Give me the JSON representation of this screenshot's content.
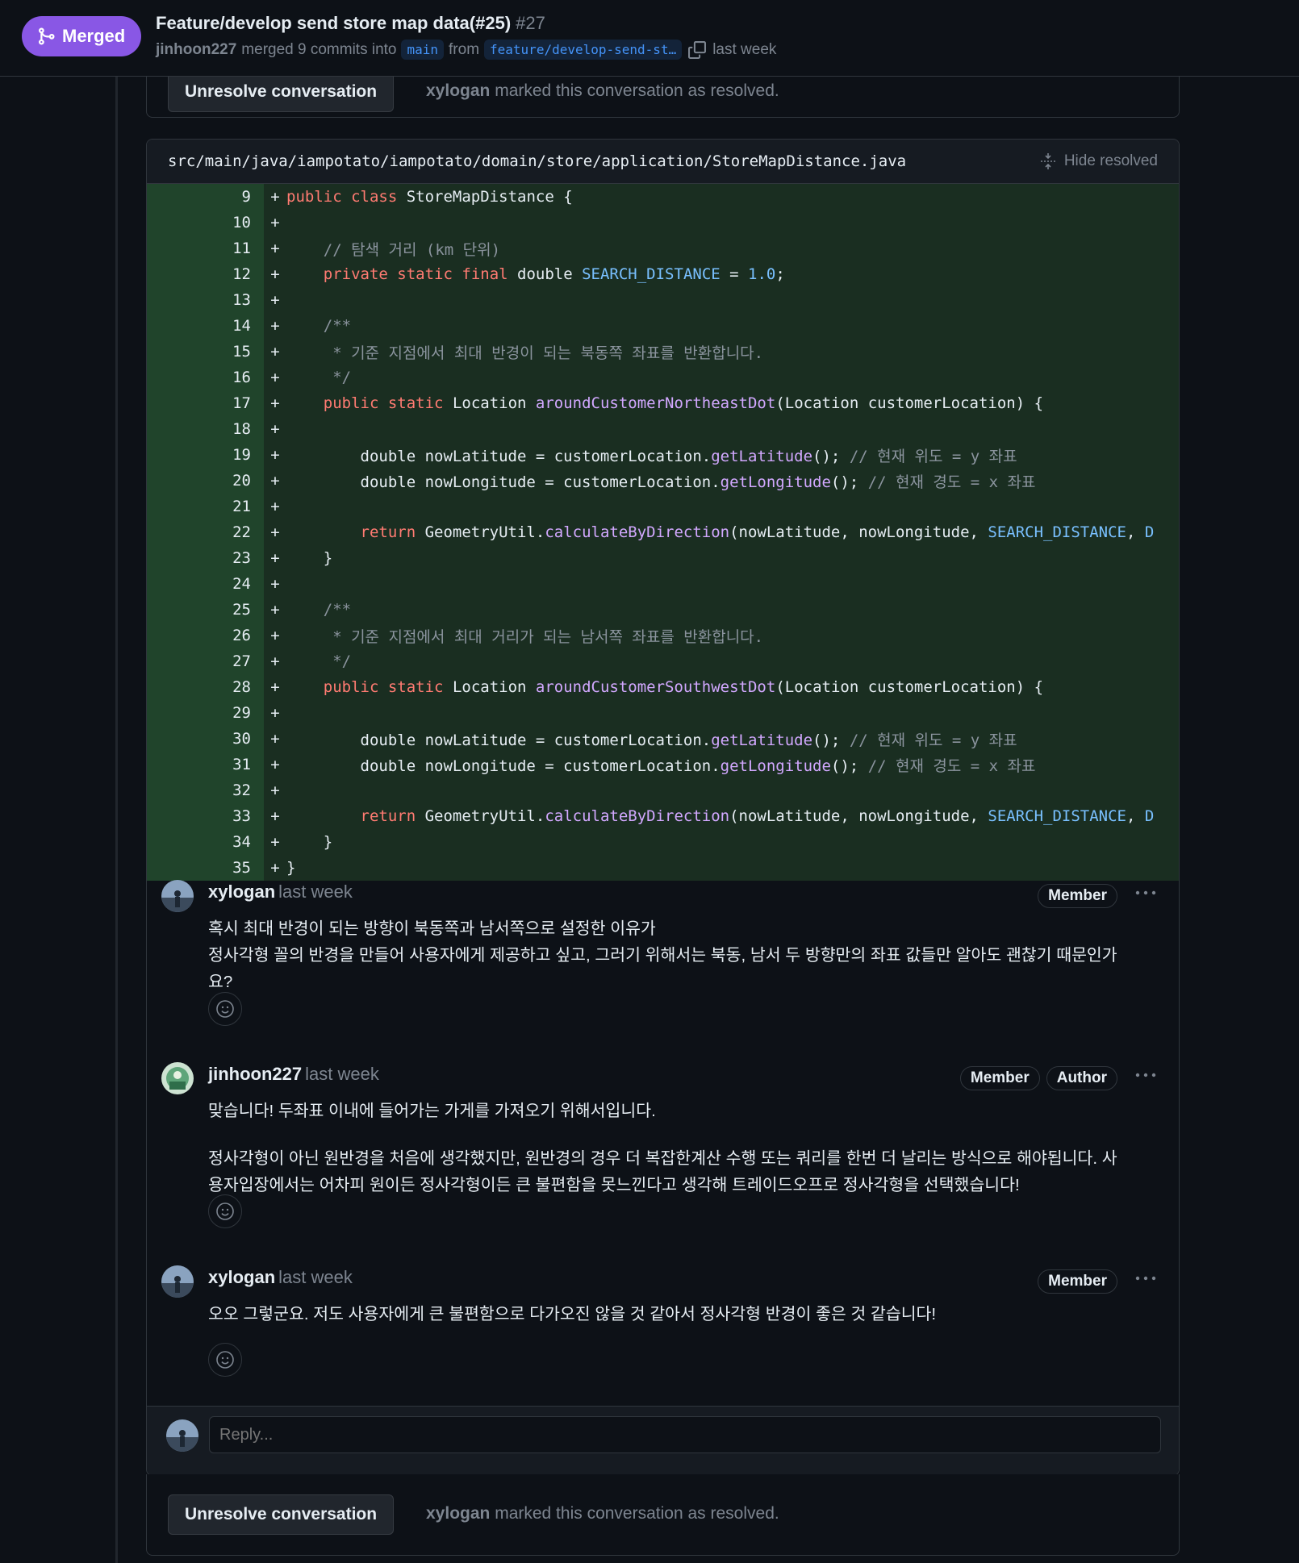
{
  "header": {
    "status": "Merged",
    "title": "Feature/develop send store map data(#25)",
    "number": "#27",
    "author": "jinhoon227",
    "merged_text": "merged 9 commits into",
    "base_branch": "main",
    "from_text": "from",
    "head_branch": "feature/develop-send-st…",
    "time": "last week"
  },
  "file": {
    "path": "src/main/java/iampotato/iampotato/domain/store/application/StoreMapDistance.java",
    "hide_resolved": "Hide resolved"
  },
  "code_lines": [
    {
      "n": "9",
      "t": "public class StoreMapDistance {"
    },
    {
      "n": "10",
      "t": ""
    },
    {
      "n": "11",
      "t": "    // 탐색 거리 (km 단위)"
    },
    {
      "n": "12",
      "t": "    private static final double SEARCH_DISTANCE = 1.0;"
    },
    {
      "n": "13",
      "t": ""
    },
    {
      "n": "14",
      "t": "    /**"
    },
    {
      "n": "15",
      "t": "     * 기준 지점에서 최대 반경이 되는 북동쪽 좌표를 반환합니다."
    },
    {
      "n": "16",
      "t": "     */"
    },
    {
      "n": "17",
      "t": "    public static Location aroundCustomerNortheastDot(Location customerLocation) {"
    },
    {
      "n": "18",
      "t": ""
    },
    {
      "n": "19",
      "t": "        double nowLatitude = customerLocation.getLatitude(); // 현재 위도 = y 좌표"
    },
    {
      "n": "20",
      "t": "        double nowLongitude = customerLocation.getLongitude(); // 현재 경도 = x 좌표"
    },
    {
      "n": "21",
      "t": ""
    },
    {
      "n": "22",
      "t": "        return GeometryUtil.calculateByDirection(nowLatitude, nowLongitude, SEARCH_DISTANCE, D"
    },
    {
      "n": "23",
      "t": "    }"
    },
    {
      "n": "24",
      "t": ""
    },
    {
      "n": "25",
      "t": "    /**"
    },
    {
      "n": "26",
      "t": "     * 기준 지점에서 최대 거리가 되는 남서쪽 좌표를 반환합니다."
    },
    {
      "n": "27",
      "t": "     */"
    },
    {
      "n": "28",
      "t": "    public static Location aroundCustomerSouthwestDot(Location customerLocation) {"
    },
    {
      "n": "29",
      "t": ""
    },
    {
      "n": "30",
      "t": "        double nowLatitude = customerLocation.getLatitude(); // 현재 위도 = y 좌표"
    },
    {
      "n": "31",
      "t": "        double nowLongitude = customerLocation.getLongitude(); // 현재 경도 = x 좌표"
    },
    {
      "n": "32",
      "t": ""
    },
    {
      "n": "33",
      "t": "        return GeometryUtil.calculateByDirection(nowLatitude, nowLongitude, SEARCH_DISTANCE, D"
    },
    {
      "n": "34",
      "t": "    }"
    },
    {
      "n": "35",
      "t": "}"
    }
  ],
  "comments": [
    {
      "author": "xylogan",
      "time": "last week",
      "badges": [
        "Member"
      ],
      "body": [
        "혹시 최대 반경이 되는 방향이 북동쪽과 남서쪽으로 설정한 이유가",
        "정사각형 꼴의 반경을 만들어 사용자에게 제공하고 싶고, 그러기 위해서는 북동, 남서 두 방향만의 좌표 값들만 알아도 괜찮기 때문인가",
        "요?"
      ]
    },
    {
      "author": "jinhoon227",
      "time": "last week",
      "badges": [
        "Member",
        "Author"
      ],
      "body": [
        "맞습니다! 두좌표 이내에 들어가는 가게를 가져오기 위해서입니다.",
        "",
        "정사각형이 아닌 원반경을 처음에 생각했지만, 원반경의 경우 더 복잡한계산 수행 또는 쿼리를 한번 더 날리는 방식으로 해야됩니다. 사",
        "용자입장에서는 어차피 원이든 정사각형이든 큰 불편함을 못느낀다고 생각해 트레이드오프로 정사각형을 선택했습니다!"
      ]
    },
    {
      "author": "xylogan",
      "time": "last week",
      "badges": [
        "Member"
      ],
      "body": [
        "오오 그렇군요. 저도 사용자에게 큰 불편함으로 다가오진 않을 것 같아서 정사각형 반경이 좋은 것 같습니다!"
      ]
    }
  ],
  "reply": {
    "placeholder": "Reply..."
  },
  "resolved": {
    "button": "Unresolve conversation",
    "user": "xylogan",
    "text": "marked this conversation as resolved."
  },
  "previous_resolved": {
    "button": "Unresolve conversation",
    "user": "xylogan",
    "text": "marked this conversation as resolved."
  },
  "colors": {
    "merged": "#8957e5",
    "added_bg": "#1a2e21",
    "keyword": "#ff7b72",
    "function": "#d2a8ff",
    "constant": "#79c0ff"
  }
}
